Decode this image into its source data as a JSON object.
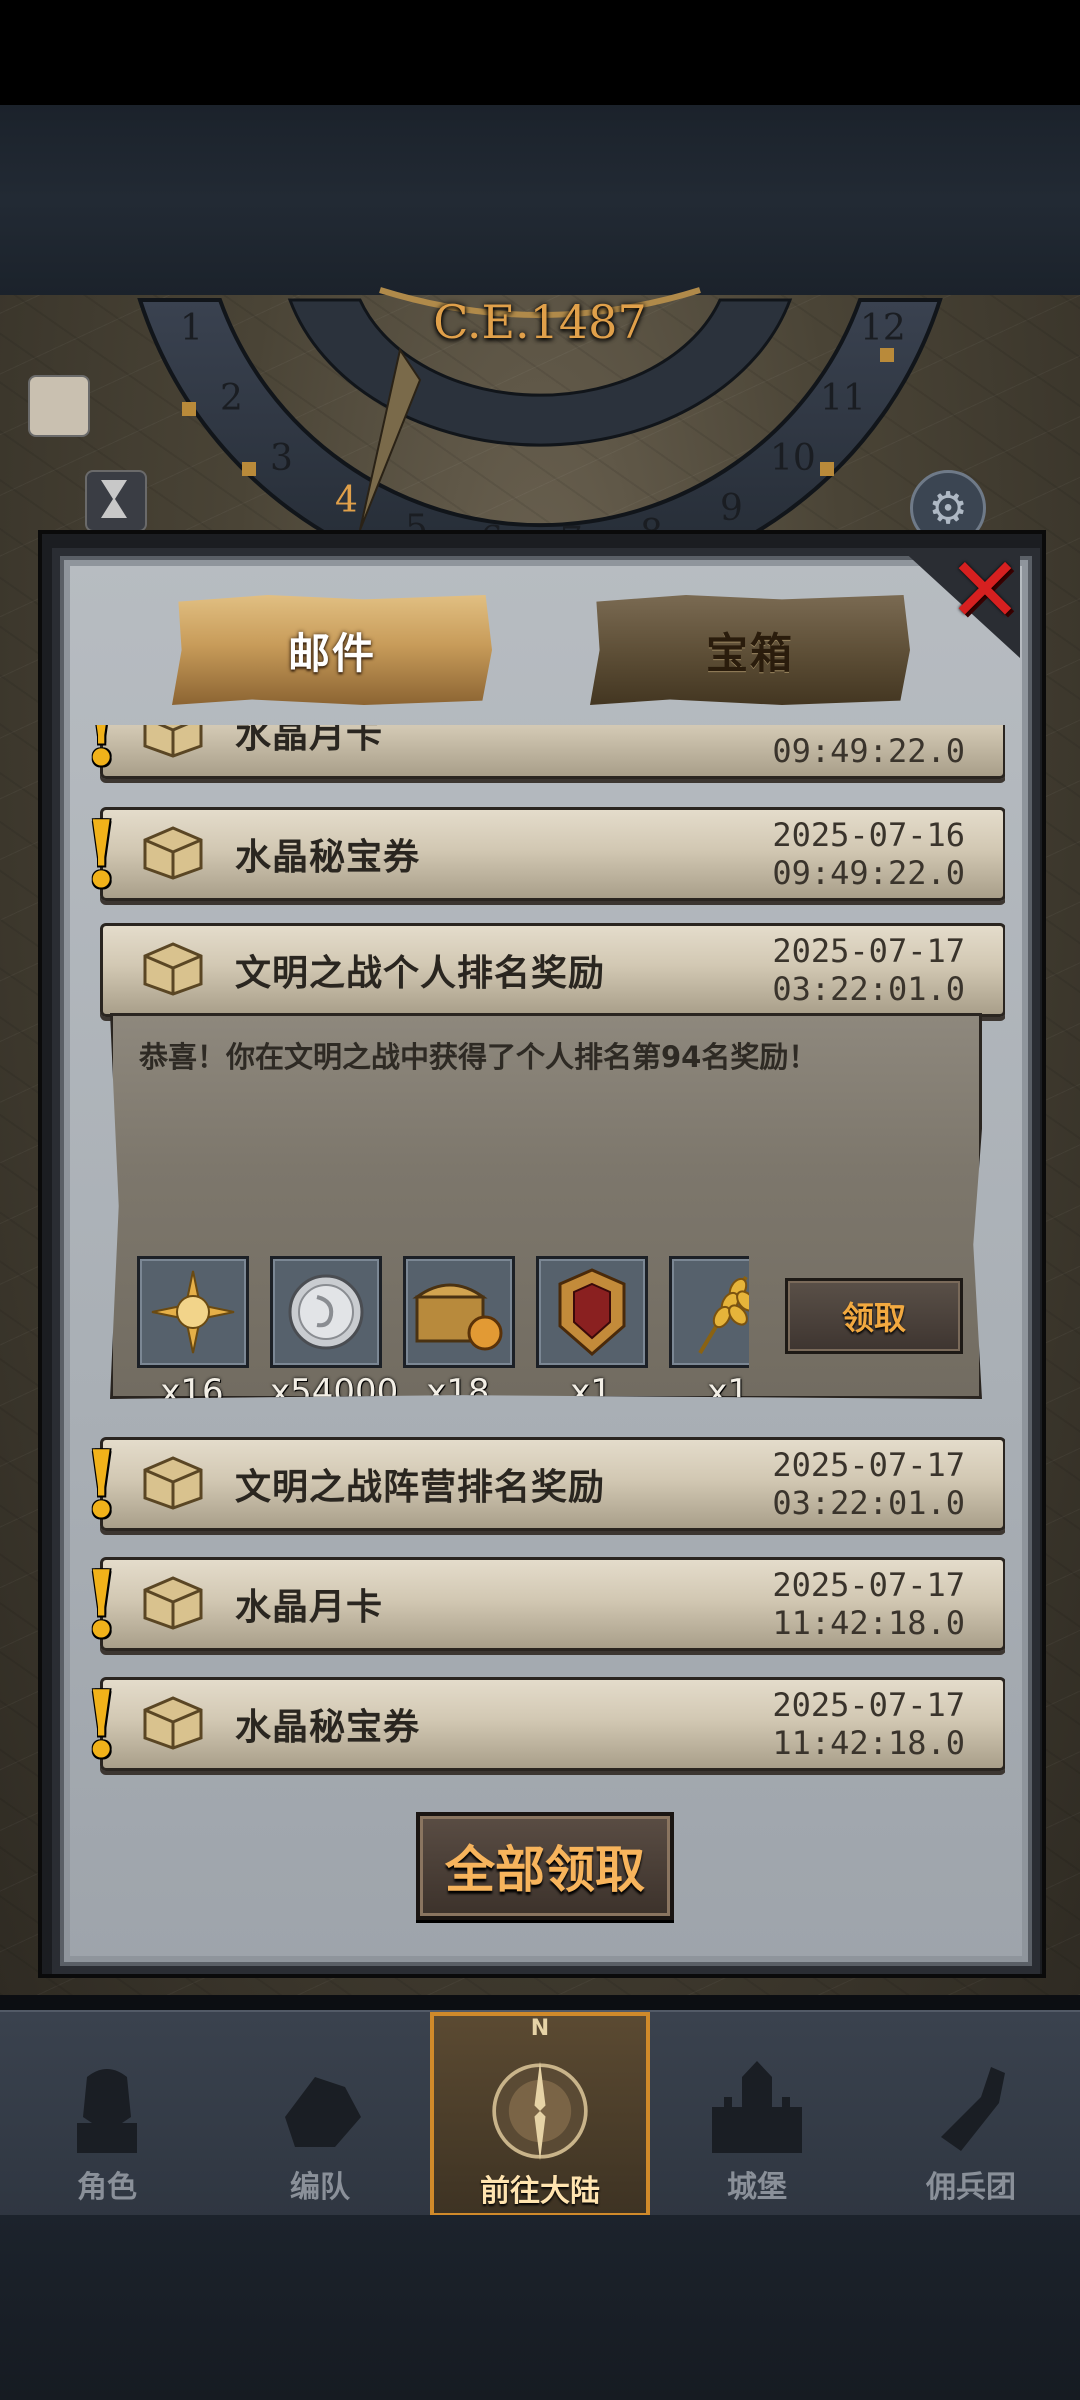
{
  "map": {
    "year": "C.E.1487"
  },
  "tabs": [
    {
      "label": "邮件",
      "active": true
    },
    {
      "label": "宝箱",
      "active": false
    }
  ],
  "mails": [
    {
      "title": "水晶月卡",
      "date": "",
      "time": "09:49:22.0",
      "unread": true
    },
    {
      "title": "水晶秘宝券",
      "date": "2025-07-16",
      "time": "09:49:22.0",
      "unread": true
    },
    {
      "title": "文明之战个人排名奖励",
      "date": "2025-07-17",
      "time": "03:22:01.0",
      "unread": false,
      "expanded": true,
      "message": "恭喜！你在文明之战中获得了个人排名第94名奖励！",
      "rewards": [
        {
          "icon": "compass-star-icon",
          "count": "x16"
        },
        {
          "icon": "silver-coin-icon",
          "count": "x54000"
        },
        {
          "icon": "treasure-chest-icon",
          "count": "x18"
        },
        {
          "icon": "shield-banner-icon",
          "count": "x1"
        },
        {
          "icon": "wheat-icon",
          "count": "x1"
        }
      ],
      "claim_label": "领取"
    },
    {
      "title": "文明之战阵营排名奖励",
      "date": "2025-07-17",
      "time": "03:22:01.0",
      "unread": true
    },
    {
      "title": "水晶月卡",
      "date": "2025-07-17",
      "time": "11:42:18.0",
      "unread": true
    },
    {
      "title": "水晶秘宝券",
      "date": "2025-07-17",
      "time": "11:42:18.0",
      "unread": true
    }
  ],
  "footer": {
    "claim_all_label": "全部领取"
  },
  "nav": [
    {
      "label": "角色",
      "icon": "knight-helmet-icon"
    },
    {
      "label": "编队",
      "icon": "armored-knight-icon"
    },
    {
      "label": "前往大陆",
      "icon": "compass-icon",
      "badge": "N",
      "active": true
    },
    {
      "label": "城堡",
      "icon": "castle-icon"
    },
    {
      "label": "佣兵团",
      "icon": "mercenary-fist-icon"
    }
  ],
  "colors": {
    "accent_gold": "#f7b45c",
    "close_red": "#d62020",
    "alert_yellow": "#f1b21a"
  }
}
